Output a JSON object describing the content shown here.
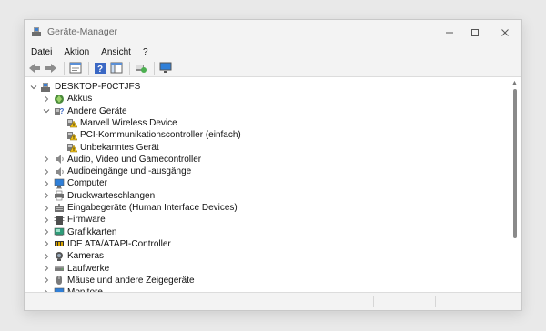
{
  "window": {
    "title": "Geräte-Manager"
  },
  "menu": {
    "items": [
      "Datei",
      "Aktion",
      "Ansicht",
      "?"
    ]
  },
  "toolbar": {
    "buttons": [
      "back-arrow-icon",
      "forward-arrow-icon",
      "properties-icon",
      "help-icon",
      "console-tree-icon",
      "scan-hardware-icon",
      "monitor-icon"
    ]
  },
  "tree": {
    "root": "DESKTOP-P0CTJFS",
    "items": [
      {
        "label": "Akkus",
        "level": 1,
        "expanded": false,
        "icon": "battery-icon"
      },
      {
        "label": "Andere Geräte",
        "level": 1,
        "expanded": true,
        "icon": "other-devices-icon"
      },
      {
        "label": "Marvell Wireless Device",
        "level": 2,
        "icon": "unknown-device-warning-icon"
      },
      {
        "label": "PCI-Kommunikationscontroller (einfach)",
        "level": 2,
        "icon": "unknown-device-warning-icon"
      },
      {
        "label": "Unbekanntes Gerät",
        "level": 2,
        "icon": "unknown-device-warning-icon"
      },
      {
        "label": "Audio, Video und Gamecontroller",
        "level": 1,
        "expanded": false,
        "icon": "speaker-icon"
      },
      {
        "label": "Audioeingänge und -ausgänge",
        "level": 1,
        "expanded": false,
        "icon": "speaker-icon"
      },
      {
        "label": "Computer",
        "level": 1,
        "expanded": false,
        "icon": "computer-icon"
      },
      {
        "label": "Druckwarteschlangen",
        "level": 1,
        "expanded": false,
        "icon": "printer-icon"
      },
      {
        "label": "Eingabegeräte (Human Interface Devices)",
        "level": 1,
        "expanded": false,
        "icon": "hid-icon"
      },
      {
        "label": "Firmware",
        "level": 1,
        "expanded": false,
        "icon": "firmware-icon"
      },
      {
        "label": "Grafikkarten",
        "level": 1,
        "expanded": false,
        "icon": "display-adapter-icon"
      },
      {
        "label": "IDE ATA/ATAPI-Controller",
        "level": 1,
        "expanded": false,
        "icon": "ide-controller-icon"
      },
      {
        "label": "Kameras",
        "level": 1,
        "expanded": false,
        "icon": "camera-icon"
      },
      {
        "label": "Laufwerke",
        "level": 1,
        "expanded": false,
        "icon": "disk-drive-icon"
      },
      {
        "label": "Mäuse und andere Zeigegeräte",
        "level": 1,
        "expanded": false,
        "icon": "mouse-icon"
      },
      {
        "label": "Monitore",
        "level": 1,
        "expanded": false,
        "icon": "monitor-icon"
      }
    ]
  }
}
